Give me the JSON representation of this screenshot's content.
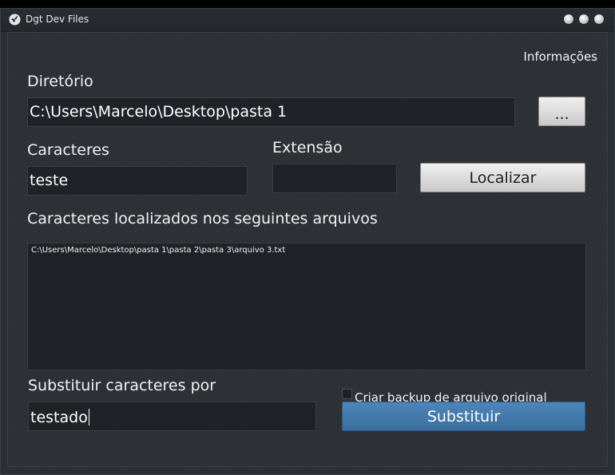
{
  "window": {
    "title": "Dgt Dev Files",
    "icon": "rocket-icon",
    "controls": [
      "minimize-dot",
      "maximize-dot",
      "close-dot"
    ]
  },
  "menu": {
    "info_label": "Informações"
  },
  "directory": {
    "label": "Diretório",
    "value": "C:\\Users\\Marcelo\\Desktop\\pasta 1",
    "browse_label": "..."
  },
  "characters": {
    "label": "Caracteres",
    "value": "teste"
  },
  "extension": {
    "label": "Extensão",
    "value": ""
  },
  "locate_button": {
    "label": "Localizar"
  },
  "results": {
    "label": "Caracteres localizados nos seguintes arquivos",
    "items": [
      "C:\\Users\\Marcelo\\Desktop\\pasta 1\\pasta 2\\pasta 3\\arquivo 3.txt"
    ]
  },
  "replace": {
    "label": "Substituir caracteres por",
    "value": "testado"
  },
  "backup": {
    "label": "Criar backup de arquivo original",
    "checked": false
  },
  "replace_button": {
    "label": "Substituir"
  },
  "colors": {
    "accent": "#3f76a8",
    "background": "#2d3136",
    "field": "#1f2226"
  }
}
